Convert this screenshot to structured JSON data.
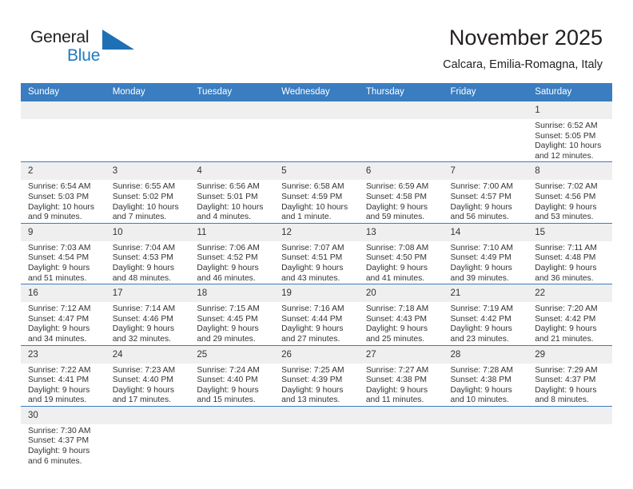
{
  "brand": {
    "name_part1": "General",
    "name_part2": "Blue",
    "logo_icon": "blue-triangle-flag-icon",
    "accent_color": "#1f7ac0"
  },
  "header": {
    "title": "November 2025",
    "subtitle": "Calcara, Emilia-Romagna, Italy"
  },
  "theme": {
    "header_bg": "#3a7dc0",
    "daynum_bg": "#efefef",
    "text": "#333333",
    "grid_line": "#3a7dc0"
  },
  "weekday_headers": [
    "Sunday",
    "Monday",
    "Tuesday",
    "Wednesday",
    "Thursday",
    "Friday",
    "Saturday"
  ],
  "weeks": [
    [
      {
        "day": "",
        "empty": true
      },
      {
        "day": "",
        "empty": true
      },
      {
        "day": "",
        "empty": true
      },
      {
        "day": "",
        "empty": true
      },
      {
        "day": "",
        "empty": true
      },
      {
        "day": "",
        "empty": true
      },
      {
        "day": "1",
        "sunrise": "Sunrise: 6:52 AM",
        "sunset": "Sunset: 5:05 PM",
        "daylight_line1": "Daylight: 10 hours",
        "daylight_line2": "and 12 minutes."
      }
    ],
    [
      {
        "day": "2",
        "sunrise": "Sunrise: 6:54 AM",
        "sunset": "Sunset: 5:03 PM",
        "daylight_line1": "Daylight: 10 hours",
        "daylight_line2": "and 9 minutes."
      },
      {
        "day": "3",
        "sunrise": "Sunrise: 6:55 AM",
        "sunset": "Sunset: 5:02 PM",
        "daylight_line1": "Daylight: 10 hours",
        "daylight_line2": "and 7 minutes."
      },
      {
        "day": "4",
        "sunrise": "Sunrise: 6:56 AM",
        "sunset": "Sunset: 5:01 PM",
        "daylight_line1": "Daylight: 10 hours",
        "daylight_line2": "and 4 minutes."
      },
      {
        "day": "5",
        "sunrise": "Sunrise: 6:58 AM",
        "sunset": "Sunset: 4:59 PM",
        "daylight_line1": "Daylight: 10 hours",
        "daylight_line2": "and 1 minute."
      },
      {
        "day": "6",
        "sunrise": "Sunrise: 6:59 AM",
        "sunset": "Sunset: 4:58 PM",
        "daylight_line1": "Daylight: 9 hours",
        "daylight_line2": "and 59 minutes."
      },
      {
        "day": "7",
        "sunrise": "Sunrise: 7:00 AM",
        "sunset": "Sunset: 4:57 PM",
        "daylight_line1": "Daylight: 9 hours",
        "daylight_line2": "and 56 minutes."
      },
      {
        "day": "8",
        "sunrise": "Sunrise: 7:02 AM",
        "sunset": "Sunset: 4:56 PM",
        "daylight_line1": "Daylight: 9 hours",
        "daylight_line2": "and 53 minutes."
      }
    ],
    [
      {
        "day": "9",
        "sunrise": "Sunrise: 7:03 AM",
        "sunset": "Sunset: 4:54 PM",
        "daylight_line1": "Daylight: 9 hours",
        "daylight_line2": "and 51 minutes."
      },
      {
        "day": "10",
        "sunrise": "Sunrise: 7:04 AM",
        "sunset": "Sunset: 4:53 PM",
        "daylight_line1": "Daylight: 9 hours",
        "daylight_line2": "and 48 minutes."
      },
      {
        "day": "11",
        "sunrise": "Sunrise: 7:06 AM",
        "sunset": "Sunset: 4:52 PM",
        "daylight_line1": "Daylight: 9 hours",
        "daylight_line2": "and 46 minutes."
      },
      {
        "day": "12",
        "sunrise": "Sunrise: 7:07 AM",
        "sunset": "Sunset: 4:51 PM",
        "daylight_line1": "Daylight: 9 hours",
        "daylight_line2": "and 43 minutes."
      },
      {
        "day": "13",
        "sunrise": "Sunrise: 7:08 AM",
        "sunset": "Sunset: 4:50 PM",
        "daylight_line1": "Daylight: 9 hours",
        "daylight_line2": "and 41 minutes."
      },
      {
        "day": "14",
        "sunrise": "Sunrise: 7:10 AM",
        "sunset": "Sunset: 4:49 PM",
        "daylight_line1": "Daylight: 9 hours",
        "daylight_line2": "and 39 minutes."
      },
      {
        "day": "15",
        "sunrise": "Sunrise: 7:11 AM",
        "sunset": "Sunset: 4:48 PM",
        "daylight_line1": "Daylight: 9 hours",
        "daylight_line2": "and 36 minutes."
      }
    ],
    [
      {
        "day": "16",
        "sunrise": "Sunrise: 7:12 AM",
        "sunset": "Sunset: 4:47 PM",
        "daylight_line1": "Daylight: 9 hours",
        "daylight_line2": "and 34 minutes."
      },
      {
        "day": "17",
        "sunrise": "Sunrise: 7:14 AM",
        "sunset": "Sunset: 4:46 PM",
        "daylight_line1": "Daylight: 9 hours",
        "daylight_line2": "and 32 minutes."
      },
      {
        "day": "18",
        "sunrise": "Sunrise: 7:15 AM",
        "sunset": "Sunset: 4:45 PM",
        "daylight_line1": "Daylight: 9 hours",
        "daylight_line2": "and 29 minutes."
      },
      {
        "day": "19",
        "sunrise": "Sunrise: 7:16 AM",
        "sunset": "Sunset: 4:44 PM",
        "daylight_line1": "Daylight: 9 hours",
        "daylight_line2": "and 27 minutes."
      },
      {
        "day": "20",
        "sunrise": "Sunrise: 7:18 AM",
        "sunset": "Sunset: 4:43 PM",
        "daylight_line1": "Daylight: 9 hours",
        "daylight_line2": "and 25 minutes."
      },
      {
        "day": "21",
        "sunrise": "Sunrise: 7:19 AM",
        "sunset": "Sunset: 4:42 PM",
        "daylight_line1": "Daylight: 9 hours",
        "daylight_line2": "and 23 minutes."
      },
      {
        "day": "22",
        "sunrise": "Sunrise: 7:20 AM",
        "sunset": "Sunset: 4:42 PM",
        "daylight_line1": "Daylight: 9 hours",
        "daylight_line2": "and 21 minutes."
      }
    ],
    [
      {
        "day": "23",
        "sunrise": "Sunrise: 7:22 AM",
        "sunset": "Sunset: 4:41 PM",
        "daylight_line1": "Daylight: 9 hours",
        "daylight_line2": "and 19 minutes."
      },
      {
        "day": "24",
        "sunrise": "Sunrise: 7:23 AM",
        "sunset": "Sunset: 4:40 PM",
        "daylight_line1": "Daylight: 9 hours",
        "daylight_line2": "and 17 minutes."
      },
      {
        "day": "25",
        "sunrise": "Sunrise: 7:24 AM",
        "sunset": "Sunset: 4:40 PM",
        "daylight_line1": "Daylight: 9 hours",
        "daylight_line2": "and 15 minutes."
      },
      {
        "day": "26",
        "sunrise": "Sunrise: 7:25 AM",
        "sunset": "Sunset: 4:39 PM",
        "daylight_line1": "Daylight: 9 hours",
        "daylight_line2": "and 13 minutes."
      },
      {
        "day": "27",
        "sunrise": "Sunrise: 7:27 AM",
        "sunset": "Sunset: 4:38 PM",
        "daylight_line1": "Daylight: 9 hours",
        "daylight_line2": "and 11 minutes."
      },
      {
        "day": "28",
        "sunrise": "Sunrise: 7:28 AM",
        "sunset": "Sunset: 4:38 PM",
        "daylight_line1": "Daylight: 9 hours",
        "daylight_line2": "and 10 minutes."
      },
      {
        "day": "29",
        "sunrise": "Sunrise: 7:29 AM",
        "sunset": "Sunset: 4:37 PM",
        "daylight_line1": "Daylight: 9 hours",
        "daylight_line2": "and 8 minutes."
      }
    ],
    [
      {
        "day": "30",
        "sunrise": "Sunrise: 7:30 AM",
        "sunset": "Sunset: 4:37 PM",
        "daylight_line1": "Daylight: 9 hours",
        "daylight_line2": "and 6 minutes."
      },
      {
        "day": "",
        "empty": true
      },
      {
        "day": "",
        "empty": true
      },
      {
        "day": "",
        "empty": true
      },
      {
        "day": "",
        "empty": true
      },
      {
        "day": "",
        "empty": true
      },
      {
        "day": "",
        "empty": true
      }
    ]
  ]
}
